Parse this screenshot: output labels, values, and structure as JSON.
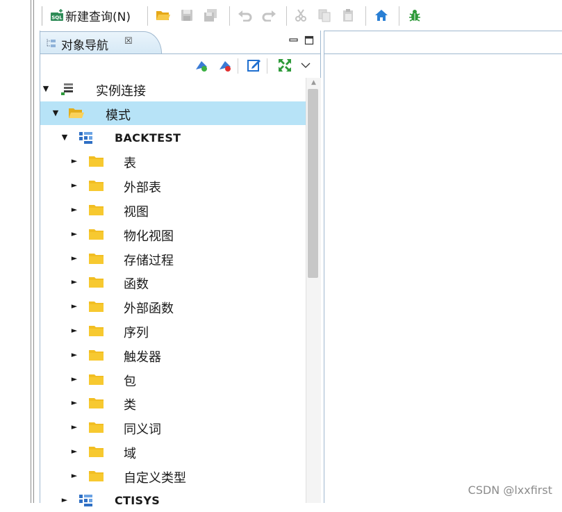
{
  "toolbar": {
    "new_query_label": "新建查询(N)",
    "sql_badge": "SQL"
  },
  "panel": {
    "tab_title": "对象导航",
    "tab_close_glyph": "☒"
  },
  "tree": {
    "root_label": "实例连接",
    "schema_folder_label": "模式",
    "schemas": [
      {
        "name": "BACKTEST",
        "expanded": true,
        "children": [
          "表",
          "外部表",
          "视图",
          "物化视图",
          "存储过程",
          "函数",
          "外部函数",
          "序列",
          "触发器",
          "包",
          "类",
          "同义词",
          "域",
          "自定义类型"
        ]
      },
      {
        "name": "CTISYS",
        "expanded": false,
        "children": []
      }
    ]
  },
  "colors": {
    "selection": "#b7e3f7",
    "folder": "#f2be22",
    "tab_gradient_top": "#eaf4fb",
    "border": "#9fb8cf"
  },
  "watermark": "CSDN @lxxfirst"
}
